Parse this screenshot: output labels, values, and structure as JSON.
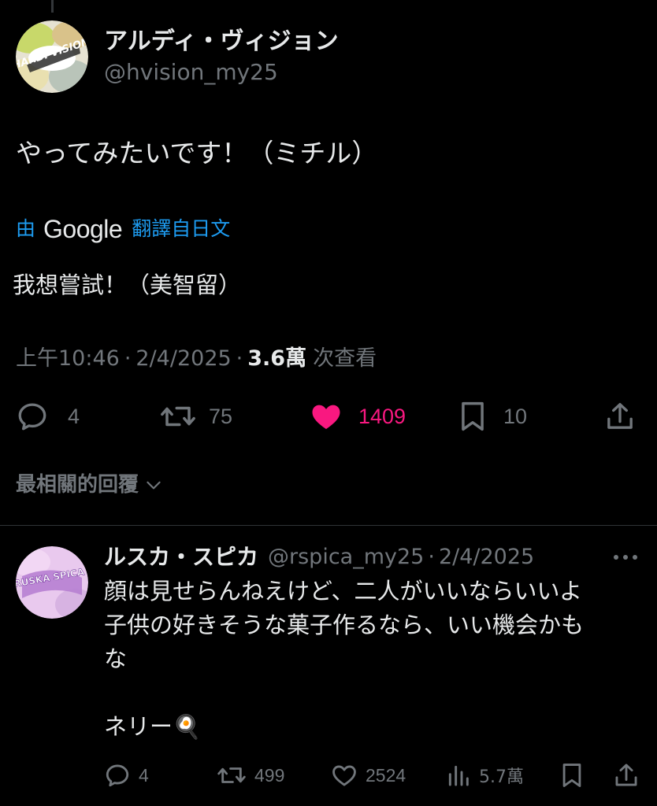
{
  "colors": {
    "background": "#000000",
    "text_primary": "#e7e9ea",
    "text_secondary": "#71767b",
    "link": "#1d9bf0",
    "like": "#f91880",
    "divider": "#2f3336"
  },
  "main_tweet": {
    "avatar_label": "HARDI VISION",
    "display_name": "アルディ・ヴィジョン",
    "handle": "@hvision_my25",
    "text": "やってみたいです！（ミチル）",
    "translation": {
      "prefix": "由",
      "provider": "Google",
      "suffix": "翻譯自日文",
      "text": "我想嘗試！（美智留）"
    },
    "meta": {
      "time": "上午10:46",
      "separator": "·",
      "date": "2/4/2025",
      "views_count": "3.6萬",
      "views_label": "次查看"
    },
    "actions": {
      "reply_count": "4",
      "repost_count": "75",
      "like_count": "1409",
      "liked": true,
      "bookmark_count": "10"
    },
    "icons": [
      "reply-icon",
      "repost-icon",
      "like-icon",
      "bookmark-icon",
      "share-icon"
    ]
  },
  "top_replies_label": "最相關的回覆",
  "reply": {
    "avatar_label": "RUSKA SPICA",
    "display_name": "ルスカ・スピカ",
    "handle": "@rspica_my25",
    "separator": "·",
    "date": "2/4/2025",
    "text_lines": [
      "顔は見せらんねえけど、二人がいいならいいよ",
      "子供の好きそうな菓子作るなら、いい機会かも",
      "な",
      "",
      "ネリー🍳"
    ],
    "actions": {
      "reply_count": "4",
      "repost_count": "499",
      "like_count": "2524",
      "views_count": "5.7萬"
    },
    "icons": [
      "reply-icon",
      "repost-icon",
      "like-icon",
      "views-icon",
      "bookmark-icon",
      "share-icon",
      "more-icon"
    ]
  }
}
